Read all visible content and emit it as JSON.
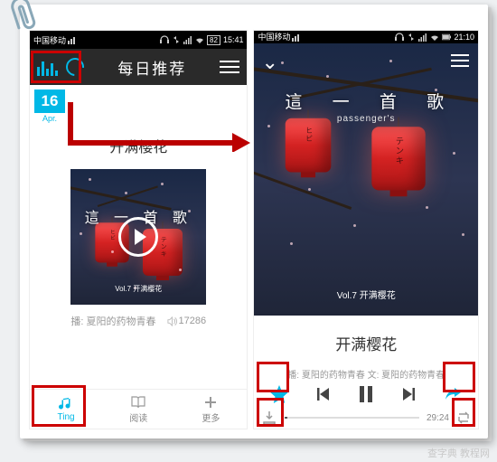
{
  "left": {
    "status": {
      "carrier": "中国移动",
      "battery": "82",
      "time": "15:41"
    },
    "nav": {
      "title": "每日推荐"
    },
    "date": {
      "day": "16",
      "month": "Apr."
    },
    "title": "开满樱花",
    "album": {
      "title": "這 一 首 歌",
      "subtitle": "Vol.7 开满樱花"
    },
    "meta": {
      "author": "播: 夏阳的药物青春",
      "plays": "17286"
    },
    "tabs": [
      {
        "icon": "music",
        "label": "Ting"
      },
      {
        "icon": "book",
        "label": "阅读"
      },
      {
        "icon": "plus",
        "label": "更多"
      }
    ]
  },
  "right": {
    "status": {
      "carrier": "中国移动",
      "battery": "",
      "time": "21:10"
    },
    "hero": {
      "title": "這 一 首 歌",
      "subtitle": "passenger's",
      "caption": "Vol.7 开满樱花"
    },
    "title": "开满樱花",
    "meta": "播: 夏阳的药物青春    文: 夏阳的药物青春",
    "time": "29:24"
  },
  "watermark": "查字典 教程网"
}
